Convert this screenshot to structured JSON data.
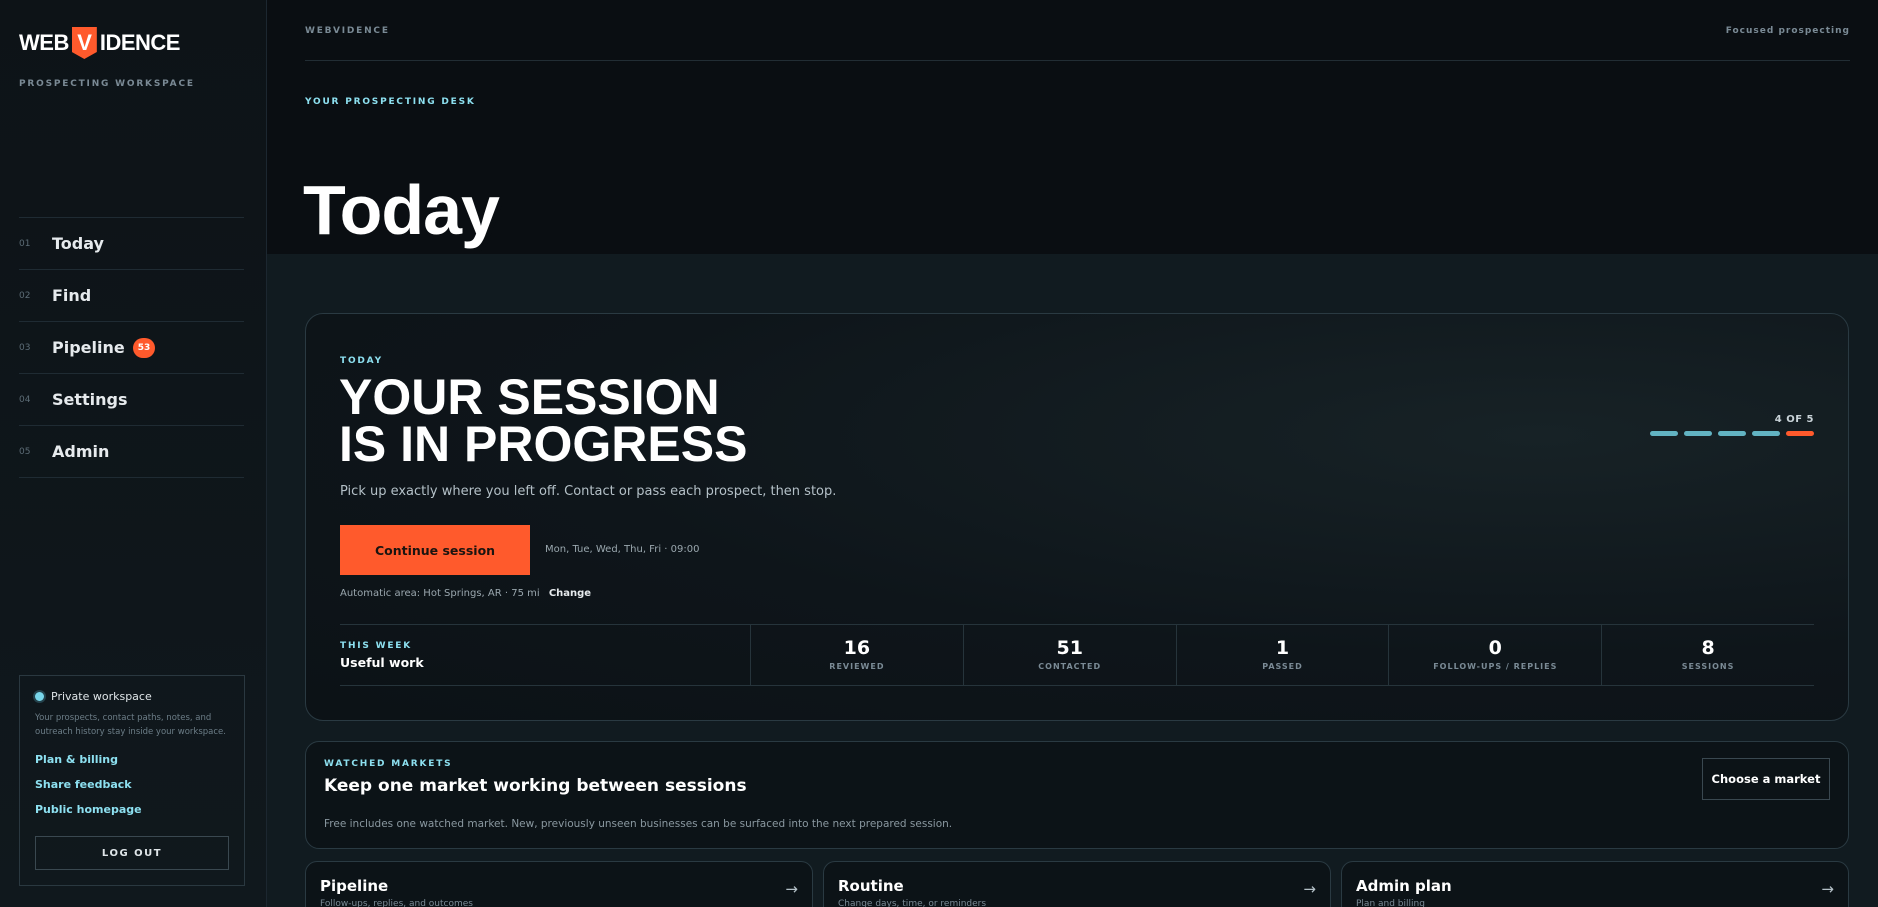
{
  "sidebar": {
    "logo_left": "WEB",
    "logo_v": "V",
    "logo_right": "IDENCE",
    "workspace_label": "PROSPECTING WORKSPACE",
    "nav": [
      {
        "num": "01",
        "label": "Today"
      },
      {
        "num": "02",
        "label": "Find"
      },
      {
        "num": "03",
        "label": "Pipeline",
        "badge": "53"
      },
      {
        "num": "04",
        "label": "Settings"
      },
      {
        "num": "05",
        "label": "Admin"
      }
    ],
    "private": {
      "title": "Private workspace",
      "desc": "Your prospects, contact paths, notes, and outreach history stay inside your workspace.",
      "links": [
        "Plan & billing",
        "Share feedback",
        "Public homepage"
      ],
      "logout": "LOG OUT"
    }
  },
  "topbar": {
    "brand": "WEBVIDENCE",
    "tagline": "Focused prospecting"
  },
  "desk_label": "YOUR PROSPECTING DESK",
  "page_title": "Today",
  "session": {
    "eyebrow": "TODAY",
    "title_line1": "YOUR SESSION",
    "title_line2": "IS IN PROGRESS",
    "subtitle": "Pick up exactly where you left off. Contact or pass each prospect, then stop.",
    "continue_label": "Continue session",
    "schedule": "Mon, Tue, Wed, Thu, Fri · 09:00",
    "auto_area": "Automatic area: Hot Springs, AR · 75 mi",
    "change_label": "Change",
    "progress_label": "4 OF 5",
    "progress_current": 4,
    "progress_total": 5,
    "week_eyebrow": "THIS WEEK",
    "week_label": "Useful work",
    "stats": [
      {
        "value": "16",
        "label": "REVIEWED"
      },
      {
        "value": "51",
        "label": "CONTACTED"
      },
      {
        "value": "1",
        "label": "PASSED"
      },
      {
        "value": "0",
        "label": "FOLLOW-UPS / REPLIES"
      },
      {
        "value": "8",
        "label": "SESSIONS"
      }
    ]
  },
  "markets": {
    "eyebrow": "WATCHED MARKETS",
    "title": "Keep one market working between sessions",
    "desc": "Free includes one watched market. New, previously unseen businesses can be surfaced into the next prepared session.",
    "button": "Choose a market"
  },
  "tiles": [
    {
      "title": "Pipeline",
      "sub": "Follow-ups, replies, and outcomes",
      "arrow": "→"
    },
    {
      "title": "Routine",
      "sub": "Change days, time, or reminders",
      "arrow": "→"
    },
    {
      "title": "Admin plan",
      "sub": "Plan and billing",
      "arrow": "→"
    }
  ],
  "colors": {
    "accent": "#ff5a2c",
    "cyan": "#8de0f0",
    "bg": "#0a0e12"
  }
}
